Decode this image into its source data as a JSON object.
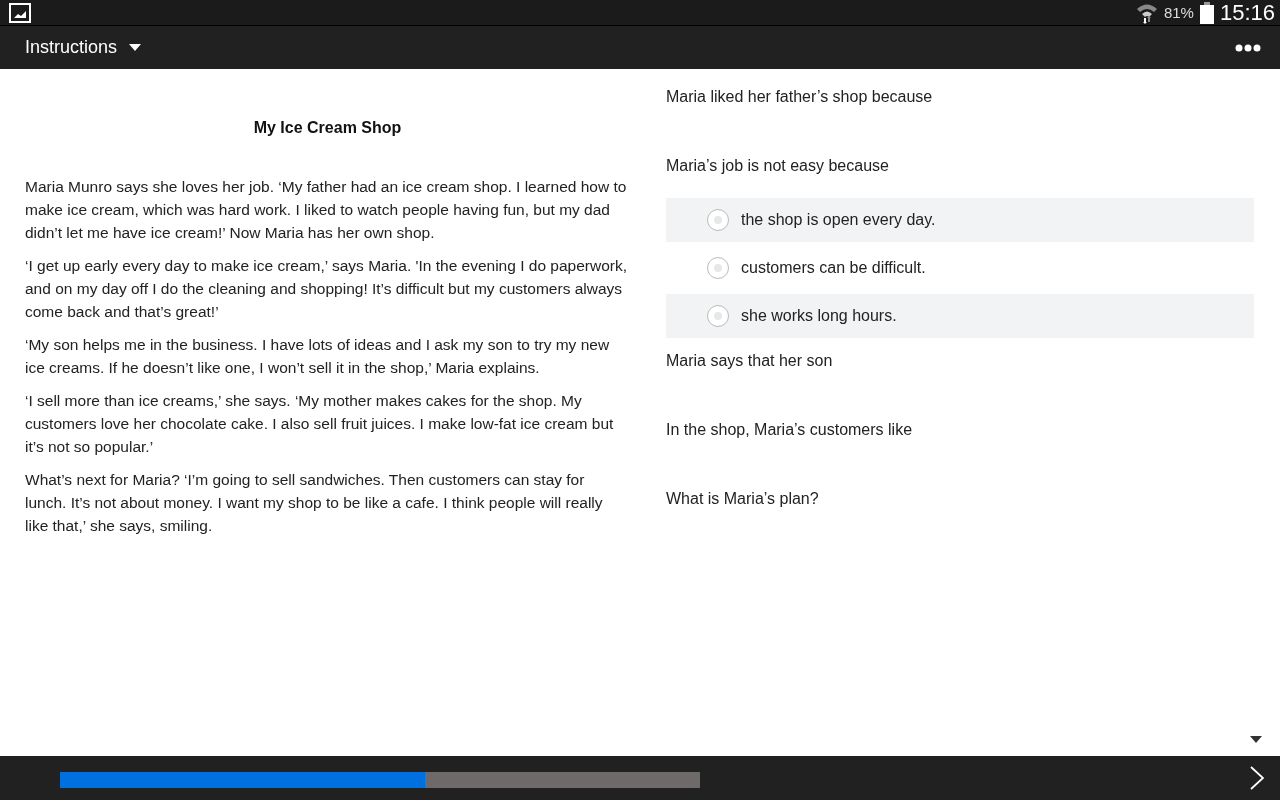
{
  "status_bar": {
    "battery": "81%",
    "time": "15:16"
  },
  "toolbar": {
    "title": "Instructions"
  },
  "passage": {
    "title": "My Ice Cream Shop",
    "paragraphs": [
      "Maria Munro says she loves her job. ‘My father had an ice cream shop. I learned how to make ice cream, which was hard work. I liked to watch people having fun, but my dad didn’t let me have ice cream!’ Now Maria has her own shop.",
      "‘I get up early every day to make ice cream,’ says Maria. 'In the evening I do paperwork, and on my day off I do the cleaning and shopping! It’s difficult but my customers always come back and that’s great!’",
      "‘My son helps me in the business. I have lots of ideas and I ask my son to try my new ice creams. If he doesn’t like one, I won’t sell it in the shop,’ Maria explains.",
      "‘I sell more than ice creams,’ she says. ‘My mother makes cakes for the shop. My customers love her chocolate cake. I also sell fruit juices. I make low-fat ice cream but it’s not so popular.’",
      "What’s next for Maria? ‘I’m going to sell sandwiches. Then customers can stay for lunch. It’s not about money. I want my shop to be like a cafe. I think people will really like that,’ she says, smiling."
    ]
  },
  "questions": [
    {
      "prompt": "Maria liked her father’s shop because"
    },
    {
      "prompt": "Maria’s job is not easy because",
      "options": [
        {
          "label": "the shop is open every day.",
          "selected": false
        },
        {
          "label": "customers can be difficult.",
          "selected": false
        },
        {
          "label": "she works long hours.",
          "selected": false
        }
      ]
    },
    {
      "prompt": "Maria says that her son"
    },
    {
      "prompt": "In the shop, Maria’s customers like"
    },
    {
      "prompt": "What is Maria’s plan?"
    }
  ],
  "progress": {
    "level": 0.57
  }
}
